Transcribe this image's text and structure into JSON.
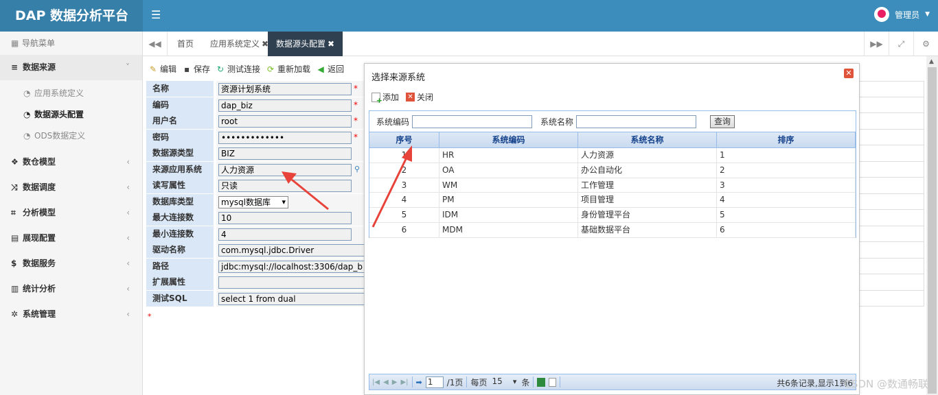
{
  "header": {
    "logo": "DAP 数据分析平台",
    "user": "管理员"
  },
  "sidebar": {
    "nav_title": "导航菜单",
    "menus": [
      {
        "label": "数据来源",
        "icon": "database-icon",
        "expanded": true,
        "children": [
          {
            "label": "应用系统定义",
            "active": false
          },
          {
            "label": "数据源头配置",
            "active": true
          },
          {
            "label": "ODS数据定义",
            "active": false
          }
        ]
      },
      {
        "label": "数仓模型",
        "icon": "cubes-icon"
      },
      {
        "label": "数据调度",
        "icon": "shuffle-icon"
      },
      {
        "label": "分析模型",
        "icon": "chart-crop-icon"
      },
      {
        "label": "展现配置",
        "icon": "film-icon"
      },
      {
        "label": "数据服务",
        "icon": "dollar-icon"
      },
      {
        "label": "统计分析",
        "icon": "bar-chart-icon"
      },
      {
        "label": "系统管理",
        "icon": "gear-icon"
      }
    ]
  },
  "tabs": [
    {
      "label": "首页",
      "closable": false,
      "active": false
    },
    {
      "label": "应用系统定义",
      "closable": true,
      "active": false
    },
    {
      "label": "数据源头配置",
      "closable": true,
      "active": true
    }
  ],
  "toolbar": {
    "edit": "编辑",
    "save": "保存",
    "test": "测试连接",
    "reload": "重新加载",
    "back": "返回"
  },
  "form": {
    "fields": [
      {
        "label": "名称",
        "value": "资源计划系统",
        "required": true
      },
      {
        "label": "编码",
        "value": "dap_biz",
        "required": true
      },
      {
        "label": "用户名",
        "value": "root",
        "required": true
      },
      {
        "label": "密码",
        "value": "•••••••••••••",
        "required": true
      },
      {
        "label": "数据源类型",
        "value": "BIZ"
      },
      {
        "label": "来源应用系统",
        "value": "人力资源"
      },
      {
        "label": "读写属性",
        "value": "只读"
      },
      {
        "label": "数据库类型",
        "value": "mysql数据库"
      },
      {
        "label": "最大连接数",
        "value": "10"
      },
      {
        "label": "最小连接数",
        "value": "4"
      },
      {
        "label": "驱动名称",
        "value": "com.mysql.jdbc.Driver"
      },
      {
        "label": "路径",
        "value": "jdbc:mysql://localhost:3306/dap_b"
      },
      {
        "label": "扩展属性",
        "value": ""
      },
      {
        "label": "测试SQL",
        "value": "select 1 from dual"
      }
    ],
    "required_mark": "*"
  },
  "dialog": {
    "title": "选择来源系统",
    "add": "添加",
    "close": "关闭",
    "search": {
      "code_label": "系统编码",
      "name_label": "系统名称",
      "query": "查询"
    },
    "columns": [
      "序号",
      "系统编码",
      "系统名称",
      "排序"
    ],
    "rows": [
      [
        "1",
        "HR",
        "人力资源",
        "1"
      ],
      [
        "2",
        "OA",
        "办公自动化",
        "2"
      ],
      [
        "3",
        "WM",
        "工作管理",
        "3"
      ],
      [
        "4",
        "PM",
        "项目管理",
        "4"
      ],
      [
        "5",
        "IDM",
        "身份管理平台",
        "5"
      ],
      [
        "6",
        "MDM",
        "基础数据平台",
        "6"
      ]
    ],
    "pager": {
      "page": "1",
      "total_pages": "/1页",
      "per_page_prefix": "每页",
      "per_page": "15",
      "per_page_suffix": "条",
      "info": "共6条记录,显示1到6"
    }
  },
  "watermark": "CSDN @数通畅联",
  "colors": {
    "header": "#3c8dbc",
    "logo_bg": "#367fa9",
    "active_tab": "#2f4050",
    "label_bg": "#dae7f6",
    "arrow": "#e8433a"
  }
}
